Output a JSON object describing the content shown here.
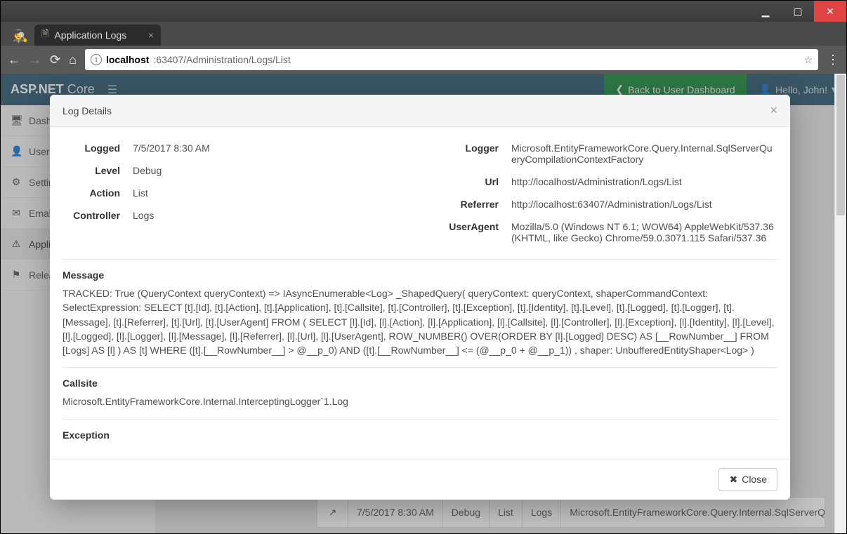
{
  "browser": {
    "tab_title": "Application Logs",
    "url_host": "localhost",
    "url_port_path": ":63407/Administration/Logs/List"
  },
  "navbar": {
    "brand_bold": "ASP.NET",
    "brand_light": " Core",
    "back_dashboard": "Back to User Dashboard",
    "user_greeting": "Hello, John!"
  },
  "sidebar": {
    "items": [
      {
        "icon": "🖥",
        "label": "Dashboard"
      },
      {
        "icon": "👤",
        "label": "Users"
      },
      {
        "icon": "⚙",
        "label": "Settings"
      },
      {
        "icon": "✉",
        "label": "Email Templates"
      },
      {
        "icon": "⚠",
        "label": "Application Logs"
      },
      {
        "icon": "⚑",
        "label": "Release Notes"
      }
    ]
  },
  "modal": {
    "title": "Log Details",
    "left": {
      "logged_label": "Logged",
      "logged_value": "7/5/2017 8:30 AM",
      "level_label": "Level",
      "level_value": "Debug",
      "action_label": "Action",
      "action_value": "List",
      "controller_label": "Controller",
      "controller_value": "Logs"
    },
    "right": {
      "logger_label": "Logger",
      "logger_value": "Microsoft.EntityFrameworkCore.Query.Internal.SqlServerQueryCompilationContextFactory",
      "url_label": "Url",
      "url_value": "http://localhost/Administration/Logs/List",
      "referrer_label": "Referrer",
      "referrer_value": "http://localhost:63407/Administration/Logs/List",
      "useragent_label": "UserAgent",
      "useragent_value": "Mozilla/5.0 (Windows NT 6.1; WOW64) AppleWebKit/537.36 (KHTML, like Gecko) Chrome/59.0.3071.115 Safari/537.36"
    },
    "message_label": "Message",
    "message_value": "TRACKED: True (QueryContext queryContext) => IAsyncEnumerable<Log> _ShapedQuery( queryContext: queryContext,  shaperCommandContext: SelectExpression: SELECT [t].[Id], [t].[Action], [t].[Application], [t].[Callsite], [t].[Controller], [t].[Exception], [t].[Identity], [t].[Level], [t].[Logged], [t].[Logger], [t].[Message], [t].[Referrer], [t].[Url], [t].[UserAgent] FROM ( SELECT [l].[Id], [l].[Action], [l].[Application], [l].[Callsite], [l].[Controller], [l].[Exception], [l].[Identity], [l].[Level], [l].[Logged], [l].[Logger], [l].[Message], [l].[Referrer], [l].[Url], [l].[UserAgent], ROW_NUMBER() OVER(ORDER BY [l].[Logged] DESC) AS [__RowNumber__] FROM [Logs] AS [l] ) AS [t] WHERE ([t].[__RowNumber__] > @__p_0) AND ([t].[__RowNumber__] <= (@__p_0 + @__p_1)) ,  shaper: UnbufferedEntityShaper<Log> )",
    "callsite_label": "Callsite",
    "callsite_value": "Microsoft.EntityFrameworkCore.Internal.InterceptingLogger`1.Log",
    "exception_label": "Exception",
    "exception_value": "",
    "close_button": "Close"
  },
  "bg_table_row": {
    "date": "7/5/2017 8:30 AM",
    "level": "Debug",
    "action": "List",
    "controller": "Logs",
    "logger": "Microsoft.EntityFrameworkCore.Query.Internal.SqlServerQueryCompilationContextFactory"
  }
}
